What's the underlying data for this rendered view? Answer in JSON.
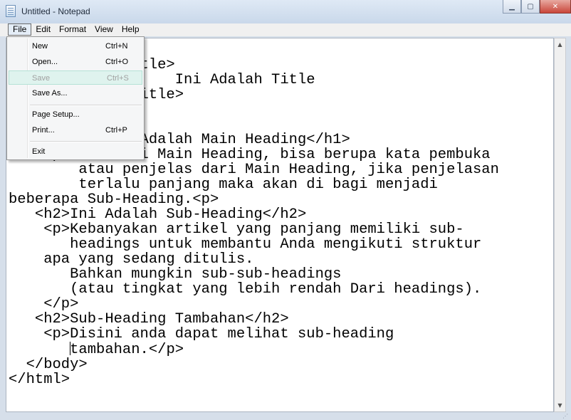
{
  "window": {
    "title": "Untitled - Notepad"
  },
  "menubar": {
    "file": "File",
    "edit": "Edit",
    "format": "Format",
    "view": "View",
    "help": "Help"
  },
  "file_menu": {
    "new": {
      "label": "New",
      "shortcut": "Ctrl+N"
    },
    "open": {
      "label": "Open...",
      "shortcut": "Ctrl+O"
    },
    "save": {
      "label": "Save",
      "shortcut": "Ctrl+S",
      "state": "disabled, hovered"
    },
    "save_as": {
      "label": "Save As..."
    },
    "page_setup": {
      "label": "Page Setup..."
    },
    "print": {
      "label": "Print...",
      "shortcut": "Ctrl+P"
    },
    "exit": {
      "label": "Exit"
    }
  },
  "editor": {
    "lines": [
      "",
      "            <title>",
      "                   Ini Adalah Title",
      "            </title>",
      "",
      "",
      "       <h1>Ini Adalah Main Heading</h1>",
      "    <p> Isi dari Main Heading, bisa berupa kata pembuka",
      "        atau penjelas dari Main Heading, jika penjelasan",
      "        terlalu panjang maka akan di bagi menjadi",
      "beberapa Sub-Heading.<p>",
      "   <h2>Ini Adalah Sub-Heading</h2>",
      "    <p>Kebanyakan artikel yang panjang memiliki sub-",
      "       headings untuk membantu Anda mengikuti struktur",
      "    apa yang sedang ditulis.",
      "       Bahkan mungkin sub-sub-headings",
      "       (atau tingkat yang lebih rendah Dari headings).",
      "    </p>",
      "   <h2>Sub-Heading Tambahan</h2>",
      "    <p>Disini anda dapat melihat sub-heading",
      "       tambahan.</p>",
      "  </body>",
      "</html>"
    ]
  },
  "colors": {
    "titlebar": "#c9d8ea",
    "menubar": "#f0f0f0",
    "dropdown": "#f5f6f7",
    "highlight": "#dff3ee",
    "disabled_text": "#a0a0a0"
  },
  "icons": {
    "app": "notepad-icon",
    "minimize": "minimize-icon",
    "maximize": "maximize-icon",
    "close": "close-icon",
    "scroll_up": "scroll-up-icon",
    "scroll_down": "scroll-down-icon"
  }
}
